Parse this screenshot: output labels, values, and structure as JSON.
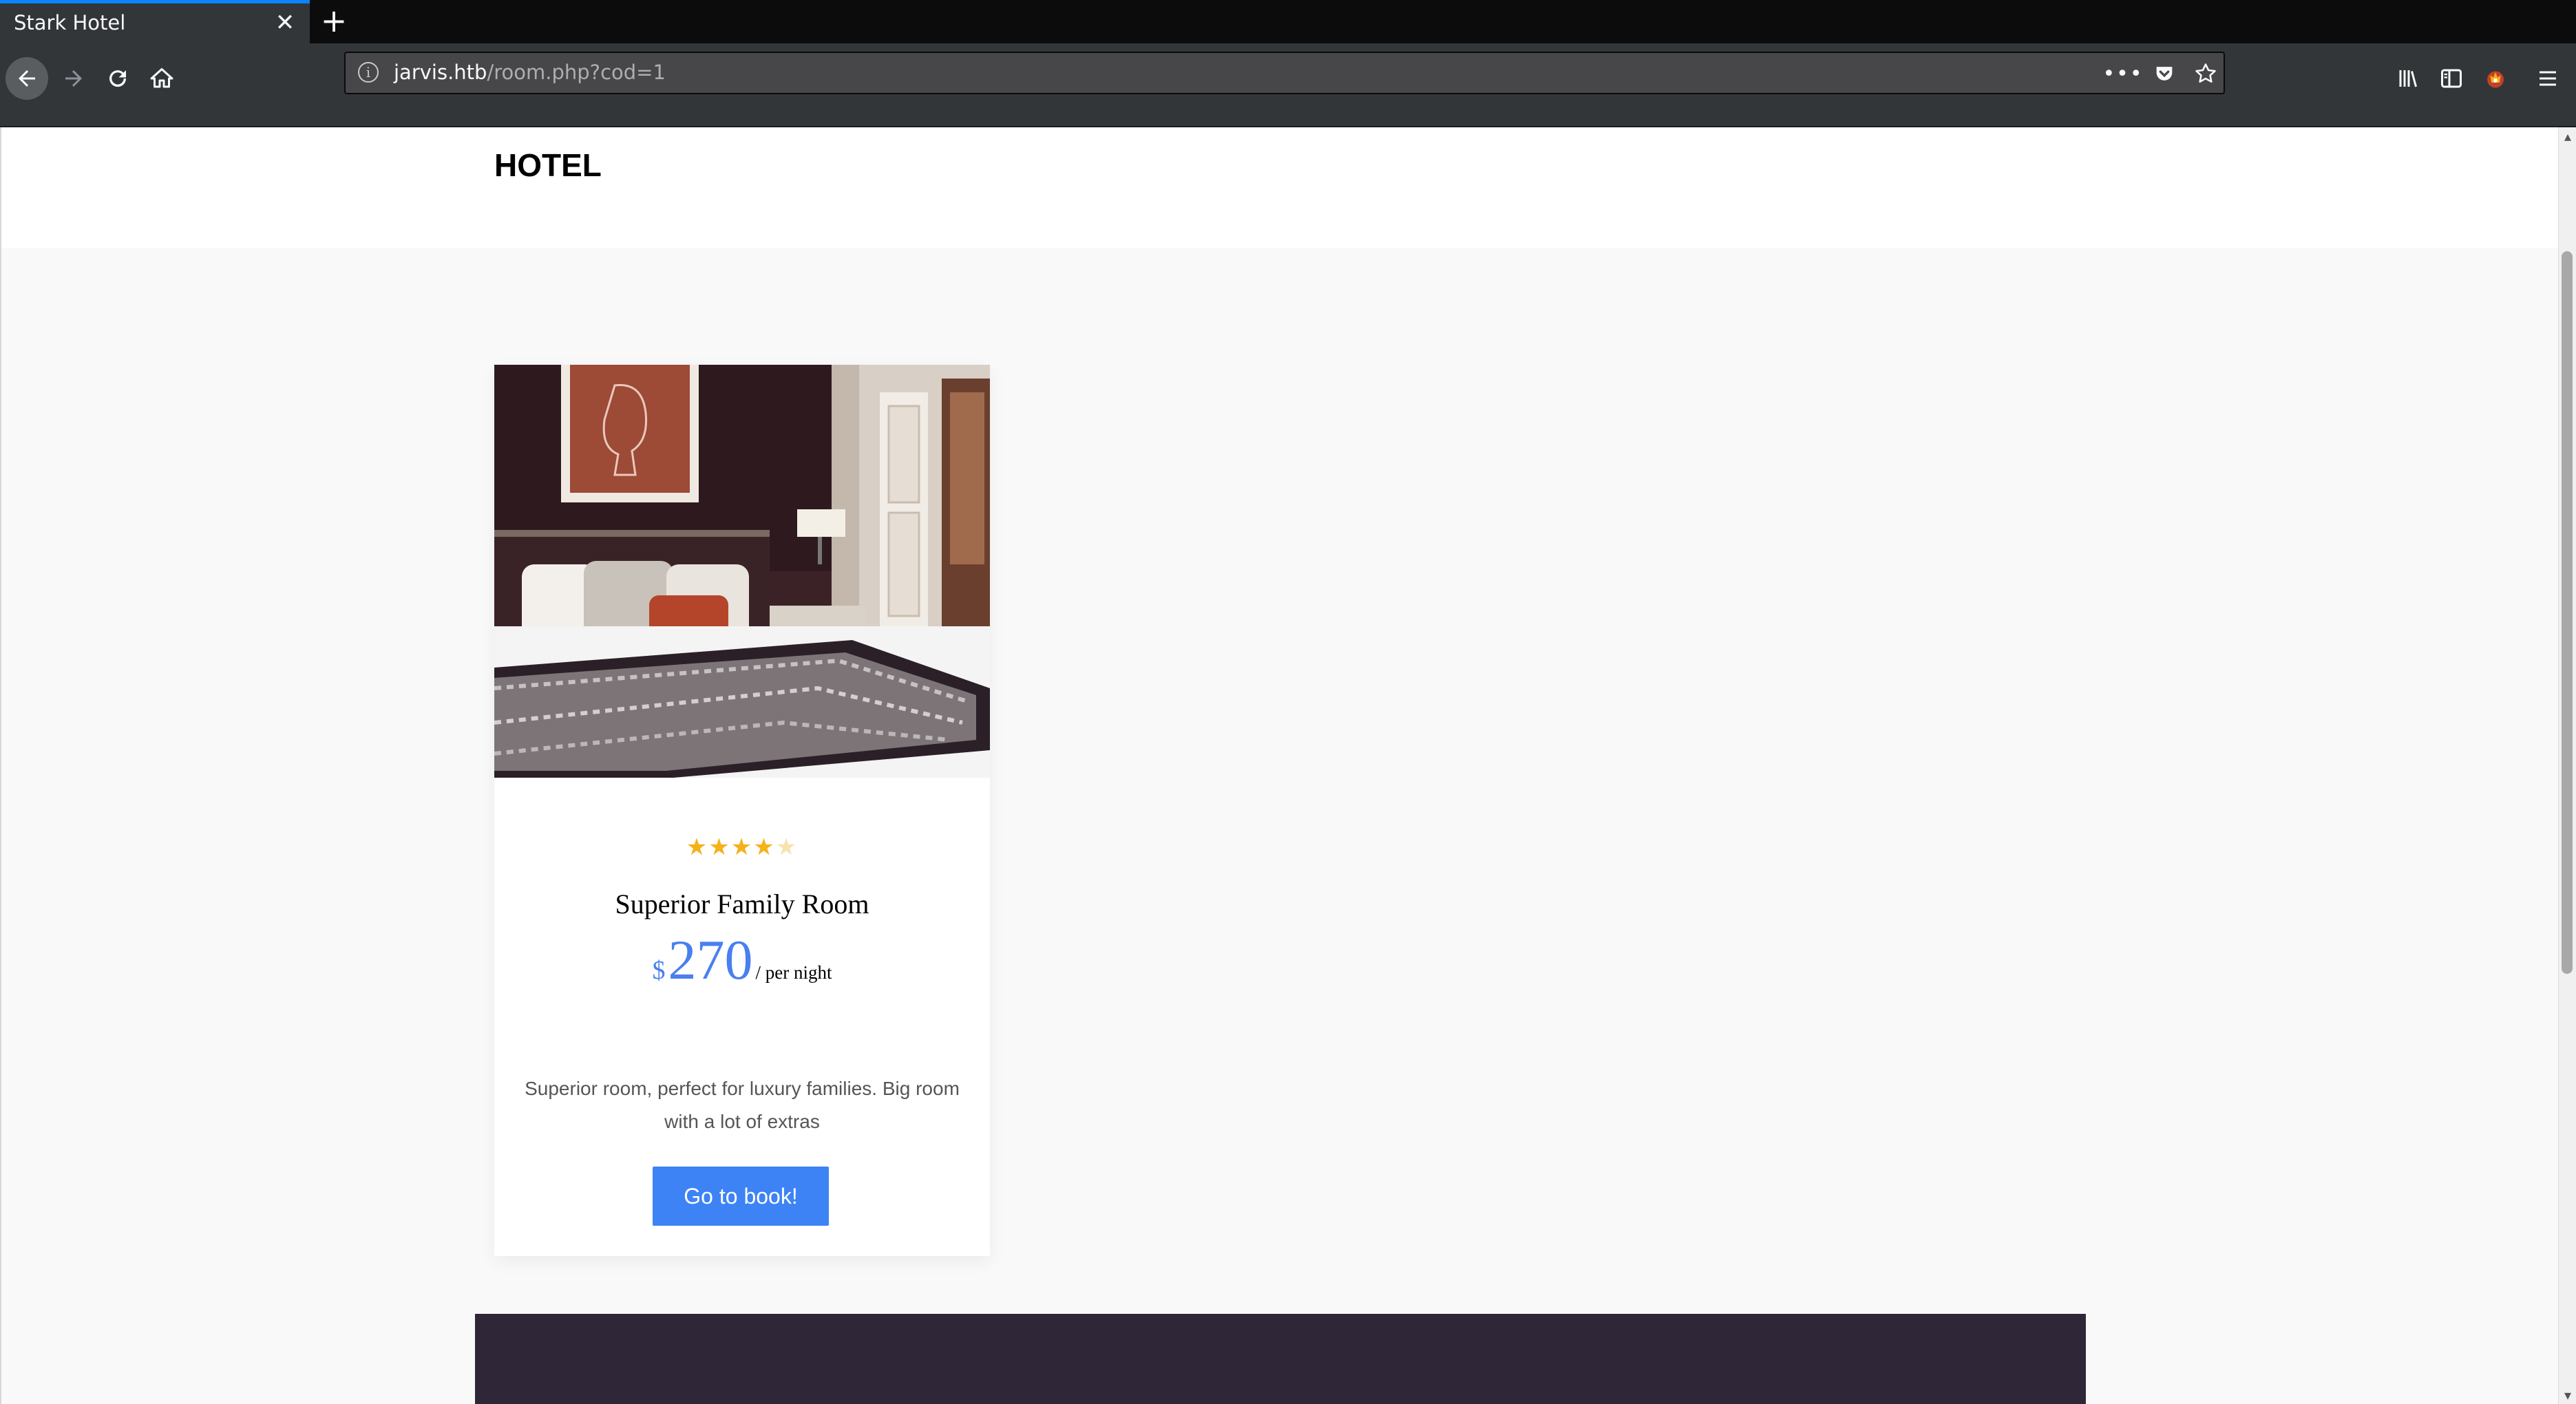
{
  "browser": {
    "tab_title": "Stark Hotel",
    "url_host": "jarvis.htb",
    "url_path": "/room.php?cod=1",
    "page_actions_label": "•••"
  },
  "site": {
    "brand": "HOTEL"
  },
  "room": {
    "rating": 4,
    "rating_max": 5,
    "name": "Superior Family Room",
    "currency": "$",
    "price": "270",
    "price_suffix": "/ per night",
    "description": "Superior room, perfect for luxury families. Big room with a lot of extras",
    "button_label": "Go to book!"
  },
  "colors": {
    "accent": "#3d83f5",
    "price": "#4a7ff0",
    "star": "#f6b11a",
    "footer": "#2f2738"
  }
}
